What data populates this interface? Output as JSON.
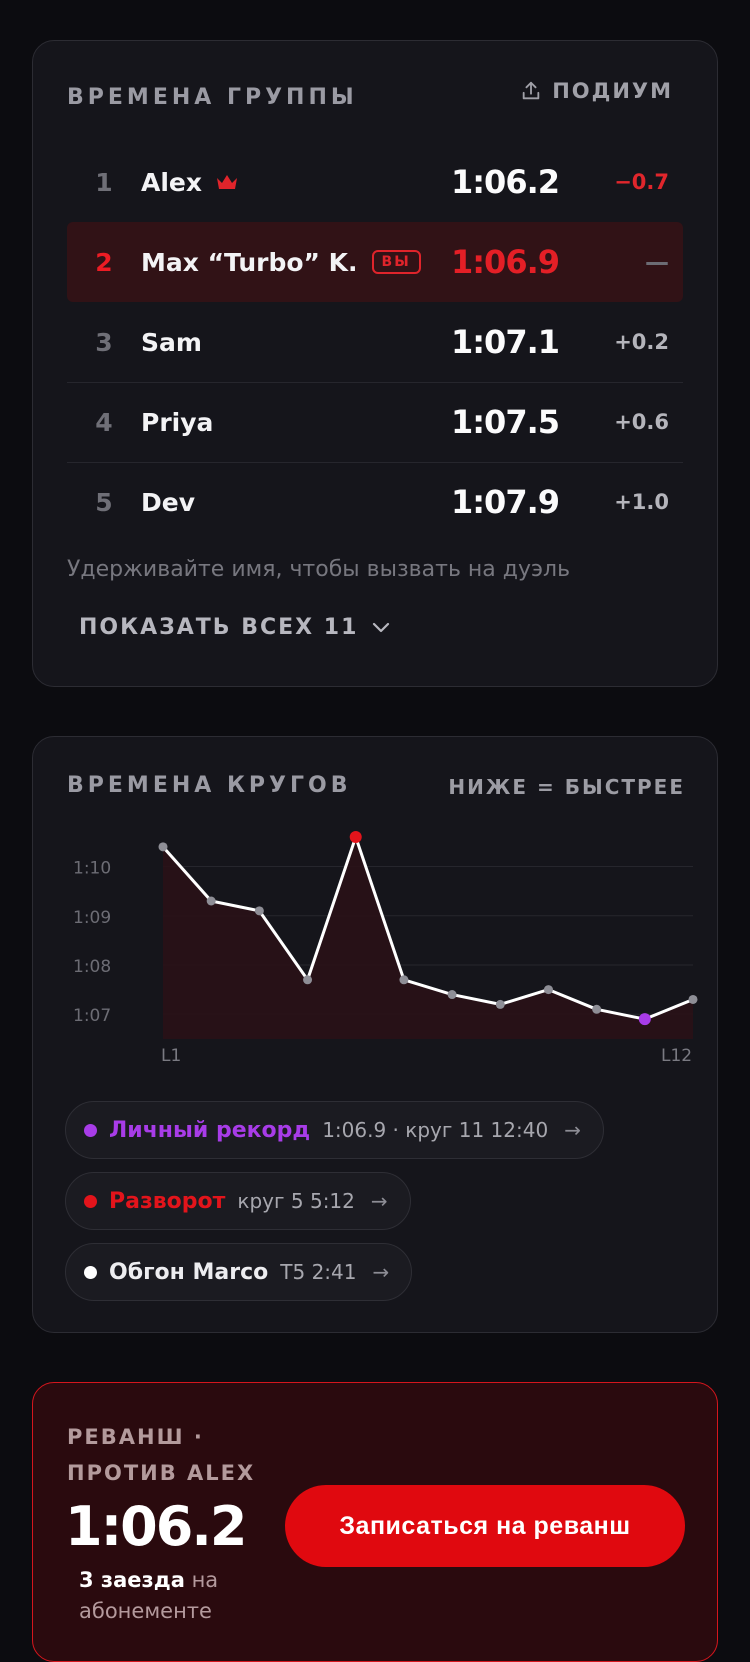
{
  "group_times": {
    "title": "ВРЕМЕНА ГРУППЫ",
    "podium_label": "ПОДИУМ",
    "podium_icon": "share-icon",
    "rows": [
      {
        "rank": "1",
        "name": "Alex",
        "time": "1:06.2",
        "gap": "−0.7",
        "leader": true
      },
      {
        "rank": "2",
        "name": "Max “Turbo” K.",
        "time": "1:06.9",
        "gap": "—",
        "you_badge": "ВЫ"
      },
      {
        "rank": "3",
        "name": "Sam",
        "time": "1:07.1",
        "gap": "+0.2"
      },
      {
        "rank": "4",
        "name": "Priya",
        "time": "1:07.5",
        "gap": "+0.6"
      },
      {
        "rank": "5",
        "name": "Dev",
        "time": "1:07.9",
        "gap": "+1.0"
      }
    ],
    "hint": "Удерживайте имя, чтобы вызвать на дуэль",
    "show_all": "ПОКАЗАТЬ ВСЕХ 11"
  },
  "lap_times": {
    "title": "ВРЕМЕНА КРУГОВ",
    "note": "НИЖЕ = БЫСТРЕЕ",
    "events": [
      {
        "label": "Личный рекорд",
        "meta": "1:06.9 · круг 11   12:40",
        "color": "#a83ce8",
        "arrow": "→"
      },
      {
        "label": "Разворот",
        "meta": "круг 5   5:12",
        "color": "#e3141b",
        "arrow": "→"
      },
      {
        "label": "Обгон Marco",
        "meta": "T5   2:41",
        "color": "#ffffff",
        "arrow": "→"
      }
    ]
  },
  "chart_data": {
    "type": "line",
    "x": [
      "L1",
      "L2",
      "L3",
      "L4",
      "L5",
      "L6",
      "L7",
      "L8",
      "L9",
      "L10",
      "L11",
      "L12"
    ],
    "x_tick_labels": [
      "L1",
      "L12"
    ],
    "y_tick_labels": [
      "1:07",
      "1:08",
      "1:09",
      "1:10"
    ],
    "y_tick_values": [
      67,
      68,
      69,
      70
    ],
    "ylim": [
      66.7,
      70.6
    ],
    "series": [
      {
        "values": [
          70.4,
          69.3,
          69.1,
          67.7,
          70.6,
          67.7,
          67.4,
          67.2,
          67.5,
          67.1,
          66.9,
          67.3
        ]
      }
    ],
    "highlights": [
      {
        "index": 4,
        "color": "#e3141b"
      },
      {
        "index": 10,
        "color": "#a83ce8"
      }
    ],
    "grid": true,
    "line_color": "#ffffff",
    "point_color": "#8e8e96"
  },
  "rematch": {
    "label": "РЕВАНШ · ПРОТИВ ALEX",
    "time": "1:06.2",
    "credits_count": "3 заезда",
    "credits_text": "на абонементе",
    "button": "Записаться на реванш"
  }
}
